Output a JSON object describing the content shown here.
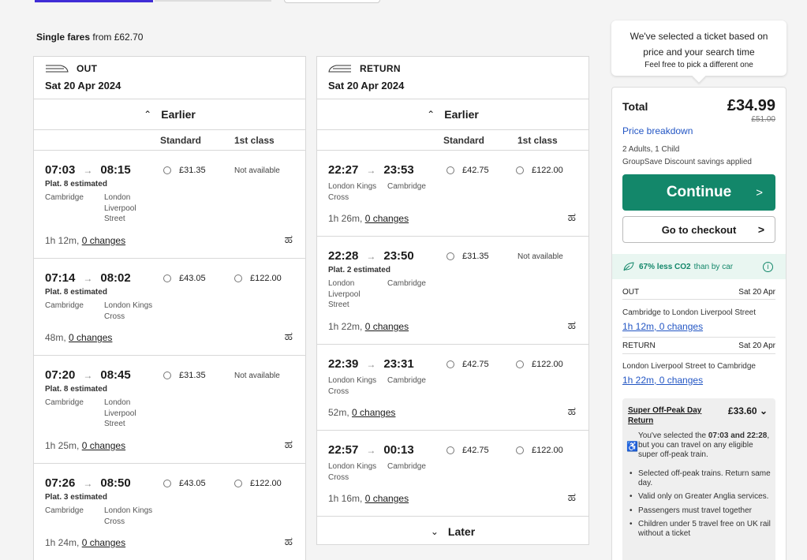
{
  "summary": {
    "single_label": "Single fares",
    "from_text": "from £62.70"
  },
  "out": {
    "dir_label": "OUT",
    "date": "Sat 20 Apr 2024",
    "earlier": "Earlier",
    "std_label": "Standard",
    "first_label": "1st class",
    "journeys": [
      {
        "dep": "07:03",
        "arr": "08:15",
        "plat": "Plat. 8 estimated",
        "from": "Cambridge",
        "to": "London\nLiverpool\nStreet",
        "dur": "1h 12m,",
        "changes": "0 changes",
        "std": "£31.35",
        "first": "Not available"
      },
      {
        "dep": "07:14",
        "arr": "08:02",
        "plat": "Plat. 8 estimated",
        "from": "Cambridge",
        "to": "London Kings\nCross",
        "dur": "48m,",
        "changes": "0 changes",
        "std": "£43.05",
        "first": "£122.00"
      },
      {
        "dep": "07:20",
        "arr": "08:45",
        "plat": "Plat. 8 estimated",
        "from": "Cambridge",
        "to": "London\nLiverpool\nStreet",
        "dur": "1h 25m,",
        "changes": "0 changes",
        "std": "£31.35",
        "first": "Not available"
      },
      {
        "dep": "07:26",
        "arr": "08:50",
        "plat": "Plat. 3 estimated",
        "from": "Cambridge",
        "to": "London Kings\nCross",
        "dur": "1h 24m,",
        "changes": "0 changes",
        "std": "£43.05",
        "first": "£122.00"
      }
    ]
  },
  "ret": {
    "dir_label": "RETURN",
    "date": "Sat 20 Apr 2024",
    "earlier": "Earlier",
    "later": "Later",
    "std_label": "Standard",
    "first_label": "1st class",
    "journeys": [
      {
        "dep": "22:27",
        "arr": "23:53",
        "plat": "",
        "from": "London Kings\nCross",
        "to": "Cambridge",
        "dur": "1h 26m,",
        "changes": "0 changes",
        "std": "£42.75",
        "first": "£122.00"
      },
      {
        "dep": "22:28",
        "arr": "23:50",
        "plat": "Plat. 2 estimated",
        "from": "London\nLiverpool\nStreet",
        "to": "Cambridge",
        "dur": "1h 22m,",
        "changes": "0 changes",
        "std": "£31.35",
        "first": "Not available"
      },
      {
        "dep": "22:39",
        "arr": "23:31",
        "plat": "",
        "from": "London Kings\nCross",
        "to": "Cambridge",
        "dur": "52m,",
        "changes": "0 changes",
        "std": "£42.75",
        "first": "£122.00"
      },
      {
        "dep": "22:57",
        "arr": "00:13",
        "plat": "",
        "from": "London Kings\nCross",
        "to": "Cambridge",
        "dur": "1h 16m,",
        "changes": "0 changes",
        "std": "£42.75",
        "first": "£122.00"
      }
    ]
  },
  "tip": {
    "line1": "We've selected a ticket based on",
    "line2": "price and your search time",
    "line3": "Feel free to pick a different one"
  },
  "panel": {
    "total_label": "Total",
    "total": "£34.99",
    "total_old": "£51.00",
    "price_breakdown": "Price breakdown",
    "passengers": "2 Adults, 1 Child",
    "groupsave": "GroupSave Discount savings applied",
    "continue": "Continue",
    "checkout": "Go to checkout",
    "co2_bold": "67% less CO2",
    "co2_rest": "than by car",
    "out_label": "OUT",
    "out_date": "Sat 20 Apr",
    "out_route": "Cambridge to London Liverpool Street",
    "out_link": "1h 12m, 0 changes",
    "ret_label": "RETURN",
    "ret_date": "Sat 20 Apr",
    "ret_route": "London Liverpool Street to Cambridge",
    "ret_link": "1h 22m, 0 changes",
    "fare_name": "Super Off-Peak Day Return",
    "fare_price": "£33.60",
    "fare_sel_1": "You've selected the",
    "fare_sel_times": "07:03 and 22:28",
    "fare_sel_2": ", but you can travel on any eligible super off-peak train.",
    "bullets": [
      "Selected off-peak trains. Return same day.",
      "Valid only on Greater Anglia services.",
      "Passengers must travel together",
      "Children under 5 travel free on UK rail without a ticket"
    ]
  }
}
